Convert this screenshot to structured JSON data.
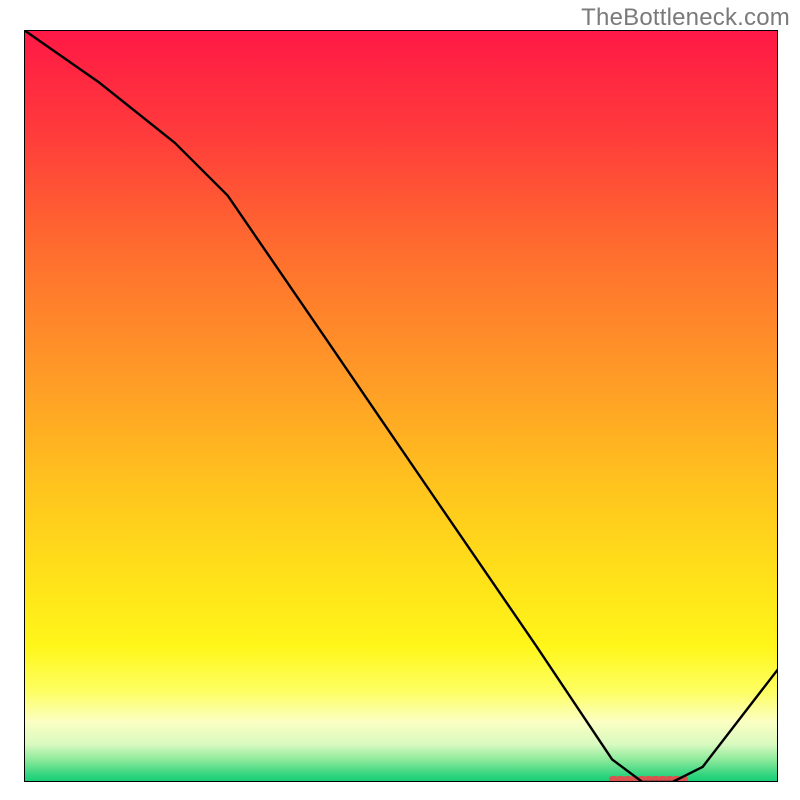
{
  "watermark": "TheBottleneck.com",
  "chart_data": {
    "type": "line",
    "title": "",
    "xlabel": "",
    "ylabel": "",
    "xlim": [
      0,
      100
    ],
    "ylim": [
      0,
      100
    ],
    "grid": false,
    "legend": false,
    "series": [
      {
        "name": "curve",
        "color": "#000000",
        "x": [
          0,
          10,
          20,
          27,
          40,
          55,
          68,
          78,
          82,
          86,
          90,
          100
        ],
        "y": [
          100,
          93,
          85,
          78,
          59,
          37,
          18,
          3,
          0,
          0,
          2,
          15
        ]
      }
    ],
    "marker": {
      "name": "optimal-range",
      "x_start": 78,
      "x_end": 88,
      "y": 0.4,
      "color": "#d9534f"
    },
    "gradient_stops": [
      {
        "pct": 0,
        "color": "#ff1846"
      },
      {
        "pct": 14,
        "color": "#ff3c3b"
      },
      {
        "pct": 30,
        "color": "#ff6f2e"
      },
      {
        "pct": 46,
        "color": "#ff9a27"
      },
      {
        "pct": 60,
        "color": "#ffc21e"
      },
      {
        "pct": 74,
        "color": "#ffe419"
      },
      {
        "pct": 82,
        "color": "#fff61a"
      },
      {
        "pct": 88,
        "color": "#feff63"
      },
      {
        "pct": 92,
        "color": "#fbffc3"
      },
      {
        "pct": 95,
        "color": "#d9fac0"
      },
      {
        "pct": 97,
        "color": "#8eea9b"
      },
      {
        "pct": 99,
        "color": "#35d580"
      },
      {
        "pct": 100,
        "color": "#14cf76"
      }
    ]
  }
}
